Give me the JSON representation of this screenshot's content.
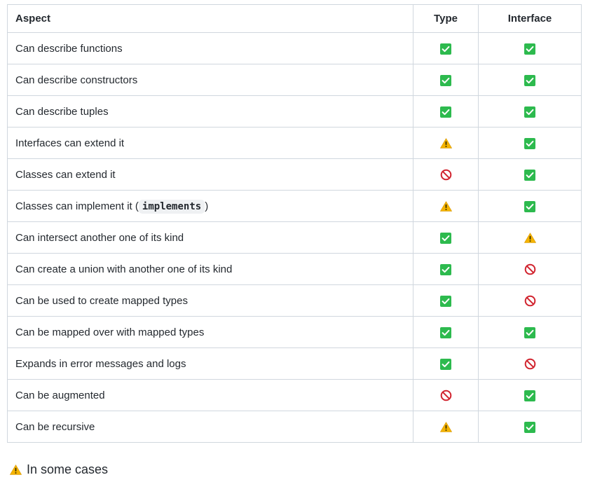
{
  "table": {
    "headers": {
      "aspect": "Aspect",
      "type": "Type",
      "interface": "Interface"
    },
    "rows": [
      {
        "aspect": "Can describe functions",
        "type": "check",
        "interface": "check"
      },
      {
        "aspect": "Can describe constructors",
        "type": "check",
        "interface": "check"
      },
      {
        "aspect": "Can describe tuples",
        "type": "check",
        "interface": "check"
      },
      {
        "aspect": "Interfaces can extend it",
        "type": "warning",
        "interface": "check"
      },
      {
        "aspect": "Classes can extend it",
        "type": "no",
        "interface": "check"
      },
      {
        "aspect_prefix": "Classes can implement it (",
        "aspect_code": "implements",
        "aspect_suffix": ")",
        "type": "warning",
        "interface": "check"
      },
      {
        "aspect": "Can intersect another one of its kind",
        "type": "check",
        "interface": "warning"
      },
      {
        "aspect": "Can create a union with another one of its kind",
        "type": "check",
        "interface": "no"
      },
      {
        "aspect": "Can be used to create mapped types",
        "type": "check",
        "interface": "no"
      },
      {
        "aspect": "Can be mapped over with mapped types",
        "type": "check",
        "interface": "check"
      },
      {
        "aspect": "Expands in error messages and logs",
        "type": "check",
        "interface": "no"
      },
      {
        "aspect": "Can be augmented",
        "type": "no",
        "interface": "check"
      },
      {
        "aspect": "Can be recursive",
        "type": "warning",
        "interface": "check"
      }
    ]
  },
  "footnote": {
    "icon": "warning",
    "text": "In some cases"
  },
  "colors": {
    "check": "#2dba4e",
    "warning": "#f5b400",
    "no": "#d1242f",
    "border": "#d0d7de"
  }
}
